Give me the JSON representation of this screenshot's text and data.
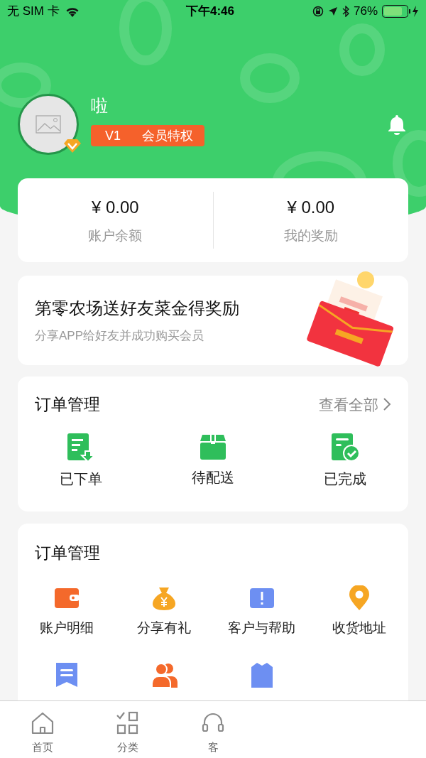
{
  "status_bar": {
    "carrier": "无 SIM 卡",
    "time": "下午4:46",
    "battery": "76%"
  },
  "profile": {
    "name": "啦",
    "level": "V1",
    "member_label": "会员特权"
  },
  "balances": [
    {
      "amount": "¥ 0.00",
      "label": "账户余额"
    },
    {
      "amount": "¥ 0.00",
      "label": "我的奖励"
    }
  ],
  "promo": {
    "title": "第零农场送好友菜金得奖励",
    "subtitle": "分享APP给好友并成功购买会员"
  },
  "orders": {
    "title": "订单管理",
    "view_all": "查看全部",
    "items": [
      {
        "kind": "placed",
        "label": "已下单"
      },
      {
        "kind": "box",
        "label": "待配送"
      },
      {
        "kind": "done",
        "label": "已完成"
      }
    ]
  },
  "services": {
    "title": "订单管理",
    "items": [
      {
        "kind": "wallet",
        "label": "账户明细"
      },
      {
        "kind": "moneybag",
        "label": "分享有礼"
      },
      {
        "kind": "alert",
        "label": "客户与帮助"
      },
      {
        "kind": "pin",
        "label": "收货地址"
      },
      {
        "kind": "bookmark"
      },
      {
        "kind": "people"
      },
      {
        "kind": "shirt"
      }
    ]
  },
  "tab_bar": [
    {
      "kind": "home",
      "label": "首页"
    },
    {
      "kind": "grid",
      "label": "分类"
    },
    {
      "kind": "headset",
      "label": "客"
    }
  ]
}
